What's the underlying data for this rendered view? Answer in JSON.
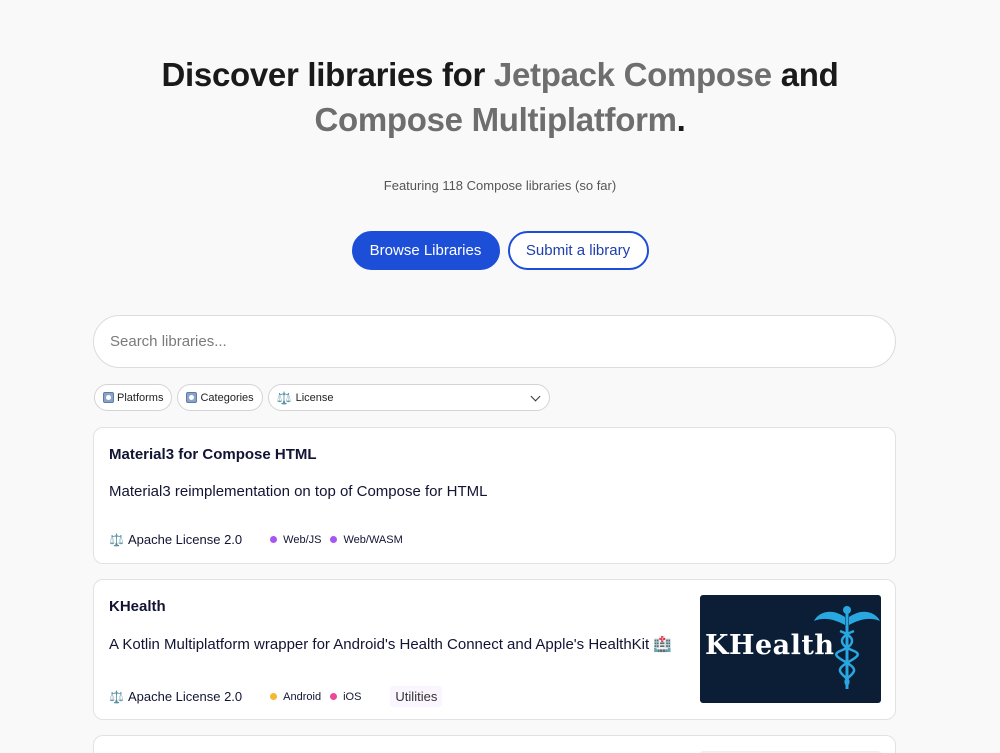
{
  "hero": {
    "title_prefix": "Discover libraries for ",
    "title_accent1": "Jetpack Compose",
    "title_mid": " and",
    "title_accent2": "Compose Multiplatform",
    "title_suffix": ".",
    "subtitle": "Featuring 118 Compose libraries (so far)"
  },
  "actions": {
    "browse_label": "Browse Libraries",
    "submit_label": "Submit a library"
  },
  "search": {
    "placeholder": "Search libraries..."
  },
  "filters": {
    "platforms_label": "Platforms",
    "categories_label": "Categories",
    "license_label": "License"
  },
  "libraries": [
    {
      "title": "Material3 for Compose HTML",
      "description": "Material3 reimplementation on top of Compose for HTML",
      "license": "Apache License 2.0",
      "platforms": [
        {
          "name": "Web/JS",
          "color": "#a855f7"
        },
        {
          "name": "Web/WASM",
          "color": "#a855f7"
        }
      ]
    },
    {
      "title": "KHealth",
      "description": "A Kotlin Multiplatform wrapper for Android's Health Connect and Apple's HealthKit 🏥",
      "license": "Apache License 2.0",
      "platforms": [
        {
          "name": "Android",
          "color": "#f5b82e"
        },
        {
          "name": "iOS",
          "color": "#ec4899"
        }
      ],
      "tag": "Utilities",
      "thumbnail_text": "KHealth"
    }
  ],
  "colors": {
    "primary": "#1d4ed8",
    "background": "#f9f9f9",
    "thumb_bg": "#0b1e36",
    "caduceus": "#29a7e1"
  }
}
